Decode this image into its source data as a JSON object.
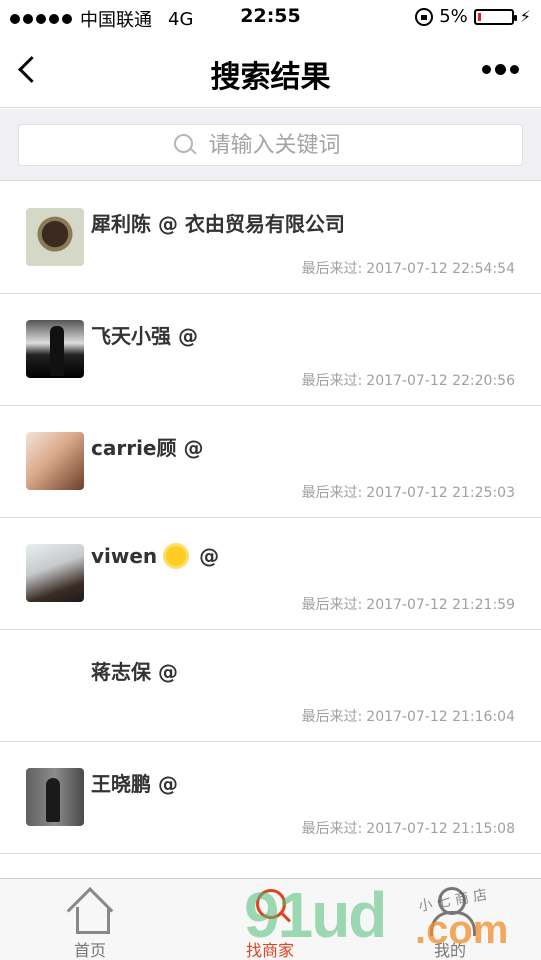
{
  "status_bar": {
    "carrier": "中国联通",
    "network": "4G",
    "time": "22:55",
    "battery": "5%"
  },
  "nav": {
    "title": "搜索结果"
  },
  "search": {
    "placeholder": "请输入关键词"
  },
  "results": [
    {
      "name": "犀利陈 @ 衣由贸易有限公司",
      "last_label": "最后来过:",
      "last_time": "2017-07-12 22:54:54"
    },
    {
      "name": "飞天小强 @",
      "last_label": "最后来过:",
      "last_time": "2017-07-12 22:20:56"
    },
    {
      "name": "carrie顾 @",
      "last_label": "最后来过:",
      "last_time": "2017-07-12 21:25:03"
    },
    {
      "name_pre": "viwen",
      "name_post": "@",
      "last_label": "最后来过:",
      "last_time": "2017-07-12 21:21:59"
    },
    {
      "name": "蒋志保 @",
      "last_label": "最后来过:",
      "last_time": "2017-07-12 21:16:04"
    },
    {
      "name": "王晓鹏 @",
      "last_label": "最后来过:",
      "last_time": "2017-07-12 21:15:08"
    }
  ],
  "tabs": [
    {
      "label": "首页",
      "icon": "home-icon"
    },
    {
      "label": "找商家",
      "icon": "search-icon",
      "active": true
    },
    {
      "label": "我的",
      "icon": "user-icon"
    }
  ],
  "watermark": {
    "big": "91ud",
    "com": ".com",
    "small": "小 七 商 店"
  },
  "colors": {
    "accent": "#e0441e",
    "divider": "#dcdcdc",
    "search_bg": "#efeff4"
  }
}
